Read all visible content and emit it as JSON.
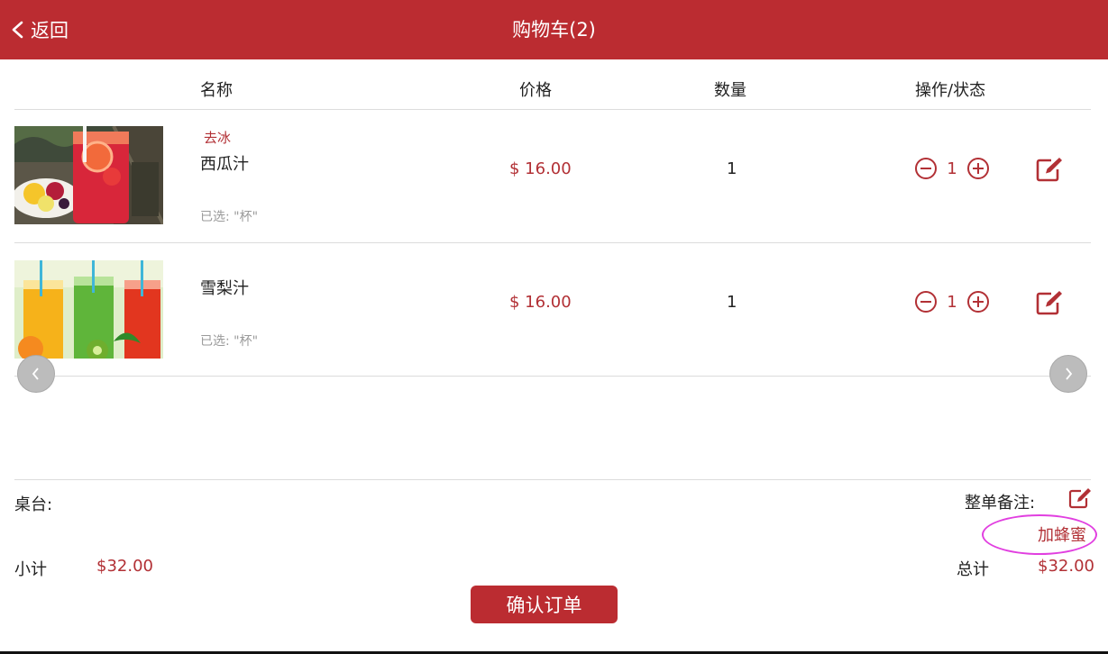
{
  "header": {
    "back_label": "返回",
    "title": "购物车(2)"
  },
  "columns": {
    "name": "名称",
    "price": "价格",
    "quantity": "数量",
    "actions": "操作/状态"
  },
  "items": [
    {
      "note": "去冰",
      "name": "西瓜汁",
      "selected": "已选: \"杯\"",
      "price": "$ 16.00",
      "quantity": "1",
      "stepper_value": "1",
      "image": "watermelon-juice-photo"
    },
    {
      "note": "",
      "name": "雪梨汁",
      "selected": "已选: \"杯\"",
      "price": "$ 16.00",
      "quantity": "1",
      "stepper_value": "1",
      "image": "pear-juice-photo"
    }
  ],
  "footer": {
    "table_label": "桌台:",
    "table_value": "",
    "order_remark_label": "整单备注:",
    "order_remark_value": "加蜂蜜",
    "subtotal_label": "小计",
    "subtotal_value": "$32.00",
    "total_label": "总计",
    "total_value": "$32.00",
    "confirm_label": "确认订单"
  },
  "icons": {
    "back": "chevron-left-icon",
    "minus": "minus-circle-icon",
    "plus": "plus-circle-icon",
    "edit": "edit-icon",
    "prev": "chevron-left-icon",
    "next": "chevron-right-icon"
  },
  "colors": {
    "brand": "#bb2c31",
    "price": "#b23035",
    "annotation": "#e13fe0"
  }
}
